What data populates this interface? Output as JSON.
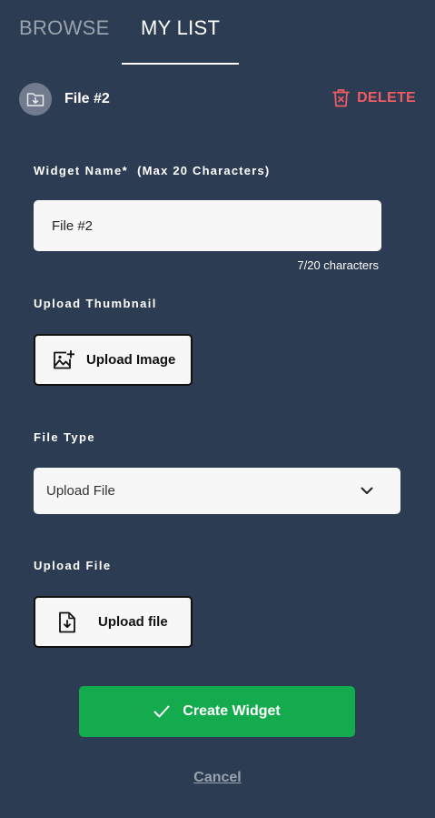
{
  "tabs": {
    "browse": "BROWSE",
    "my_list": "MY LIST",
    "active": "my_list"
  },
  "file_header": {
    "title": "File #2",
    "folder_icon": "folder-download-icon",
    "delete_label": "DELETE",
    "delete_icon": "trash-icon"
  },
  "widget_name": {
    "label": "Widget Name*",
    "hint": "(Max 20 Characters)",
    "value": "File #2",
    "char_count": "7/20 characters"
  },
  "thumbnail": {
    "label": "Upload Thumbnail",
    "button_label": "Upload Image",
    "icon": "image-add-icon"
  },
  "file_type": {
    "label": "File Type",
    "selected": "Upload File",
    "icon": "chevron-down-icon"
  },
  "upload_file": {
    "label": "Upload File",
    "button_label": "Upload file",
    "icon": "file-download-icon"
  },
  "actions": {
    "create_label": "Create Widget",
    "create_icon": "check-icon",
    "cancel_label": "Cancel"
  },
  "colors": {
    "background": "#2c3c52",
    "accent_green": "#13ab4d",
    "delete_red": "#f05b64",
    "muted_text": "#9aa3ad"
  }
}
